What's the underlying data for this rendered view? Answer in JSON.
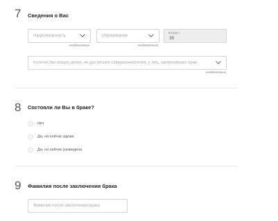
{
  "section7": {
    "number": "7",
    "title": "Сведения о Вас",
    "nationality": {
      "placeholder": "Национальность",
      "note": "необязательно"
    },
    "education": {
      "placeholder": "Образование",
      "note": "необязательно"
    },
    "age": {
      "label": "Возраст",
      "value": "35"
    },
    "children": {
      "placeholder": "Количество общих детей, не достигших совершеннолетия, у лиц, заключивших брак",
      "note": "необязательно"
    }
  },
  "section8": {
    "number": "8",
    "title": "Состояли ли Вы в браке?",
    "options": [
      {
        "label": "Нет"
      },
      {
        "label": "Да, но сейчас вдова"
      },
      {
        "label": "Да, но сейчас разведена"
      }
    ]
  },
  "section9": {
    "number": "9",
    "title": "Фамилия после заключения брака",
    "input": {
      "placeholder": "Фамилия после заключения брака"
    }
  },
  "icons": {
    "chevron": "chevron-down-icon"
  },
  "colors": {
    "chevron": "#555555",
    "border": "#d3d3d3",
    "readonly_bg": "#eeeeee"
  }
}
